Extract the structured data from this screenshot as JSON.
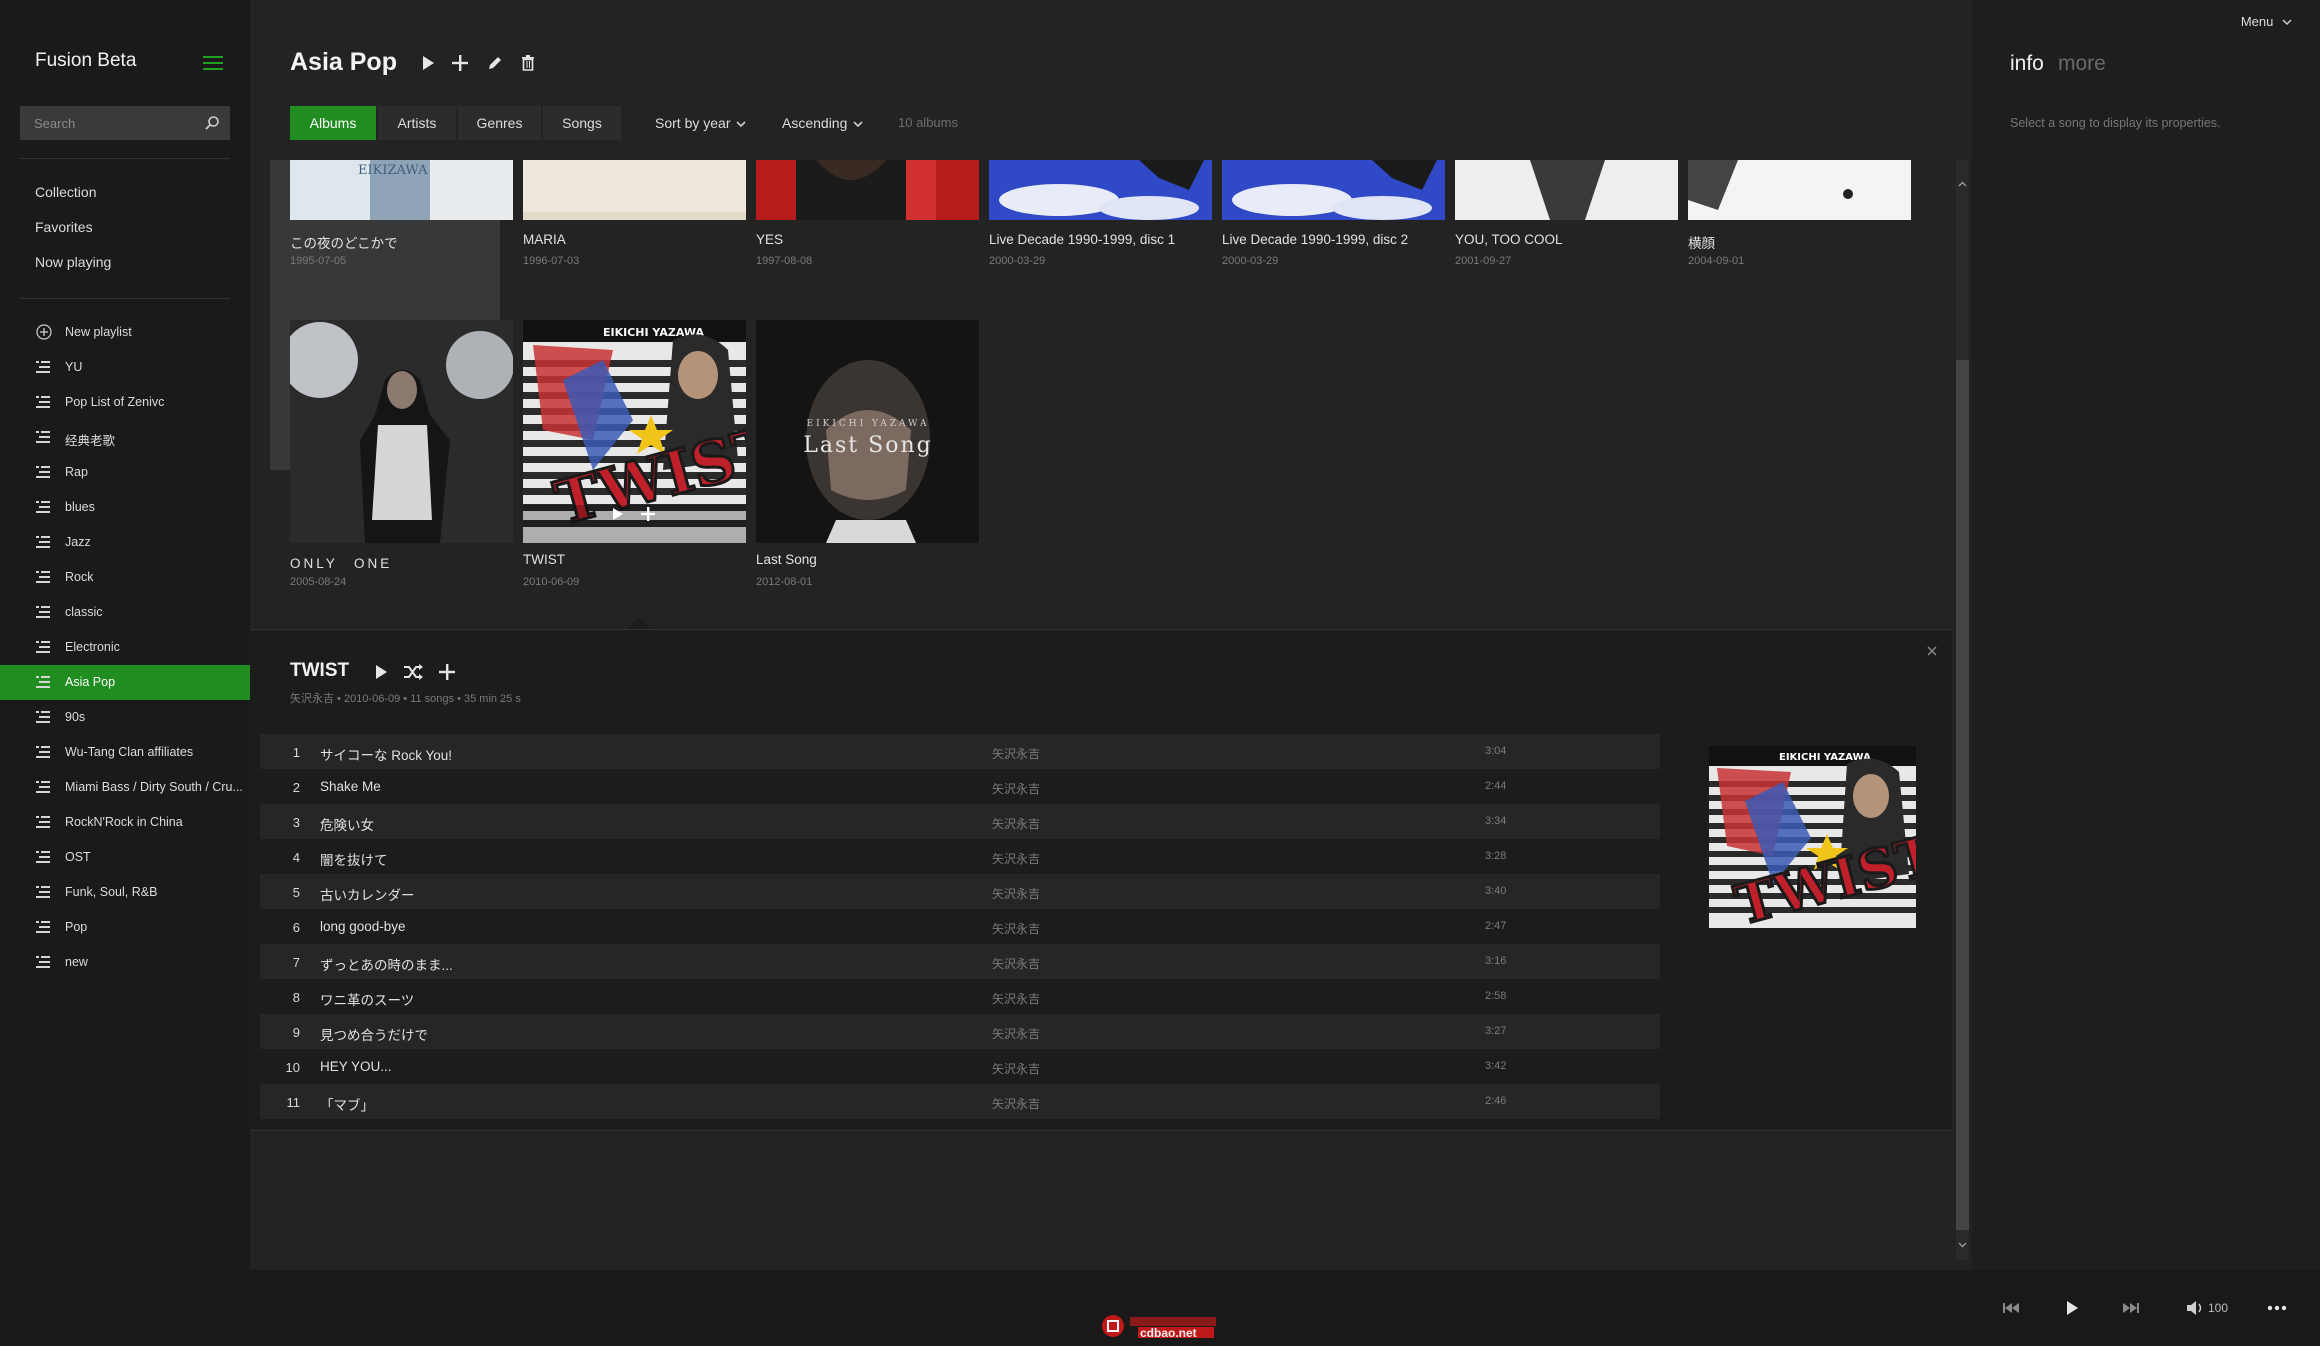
{
  "app": {
    "title": "Fusion Beta"
  },
  "search": {
    "placeholder": "Search"
  },
  "nav": {
    "items": [
      "Collection",
      "Favorites",
      "Now playing"
    ]
  },
  "playlists": {
    "new_label": "New playlist",
    "items": [
      "YU",
      "Pop List of Zenivc",
      "经典老歌",
      "Rap",
      "blues",
      "Jazz",
      "Rock",
      "classic",
      "Electronic",
      "Asia Pop",
      "90s",
      "Wu-Tang Clan affiliates",
      "Miami Bass / Dirty South / Cru...",
      "RockN'Rock in China",
      "OST",
      "Funk, Soul, R&B",
      "Pop",
      "new"
    ],
    "active": "Asia Pop"
  },
  "header": {
    "title": "Asia Pop"
  },
  "tabs": [
    "Albums",
    "Artists",
    "Genres",
    "Songs"
  ],
  "sort": {
    "label": "Sort by year"
  },
  "order": {
    "label": "Ascending"
  },
  "album_count": "10 albums",
  "albums": [
    {
      "title": "この夜のどこかで",
      "date": "1995-07-05"
    },
    {
      "title": "MARIA",
      "date": "1996-07-03"
    },
    {
      "title": "YES",
      "date": "1997-08-08"
    },
    {
      "title": "Live Decade 1990-1999, disc 1",
      "date": "2000-03-29"
    },
    {
      "title": "Live Decade 1990-1999, disc 2",
      "date": "2000-03-29"
    },
    {
      "title": "YOU, TOO COOL",
      "date": "2001-09-27"
    },
    {
      "title": "横顔",
      "date": "2004-09-01"
    },
    {
      "title": "ONLY　ONE",
      "date": "2005-08-24"
    },
    {
      "title": "TWIST",
      "date": "2010-06-09"
    },
    {
      "title": "Last Song",
      "date": "2012-08-01"
    }
  ],
  "art_text": {
    "top_fragment": "EIKIZAWA",
    "twist_band": "EIKICHI YAZAWA",
    "twist_word": "TWIST",
    "last_artist": "EIKICHI YAZAWA",
    "last_title": "Last Song"
  },
  "detail": {
    "title": "TWIST",
    "meta": "矢沢永吉 • 2010-06-09 • 11 songs • 35 min 25 s",
    "tracks": [
      {
        "num": "1",
        "title": "サイコーな Rock You!",
        "artist": "矢沢永吉",
        "duration": "3:04"
      },
      {
        "num": "2",
        "title": "Shake Me",
        "artist": "矢沢永吉",
        "duration": "2:44"
      },
      {
        "num": "3",
        "title": "危険い女",
        "artist": "矢沢永吉",
        "duration": "3:34"
      },
      {
        "num": "4",
        "title": "闇を抜けて",
        "artist": "矢沢永吉",
        "duration": "3:28"
      },
      {
        "num": "5",
        "title": "古いカレンダー",
        "artist": "矢沢永吉",
        "duration": "3:40"
      },
      {
        "num": "6",
        "title": "long good-bye",
        "artist": "矢沢永吉",
        "duration": "2:47"
      },
      {
        "num": "7",
        "title": "ずっとあの時のまま...",
        "artist": "矢沢永吉",
        "duration": "3:16"
      },
      {
        "num": "8",
        "title": "ワニ革のスーツ",
        "artist": "矢沢永吉",
        "duration": "2:58"
      },
      {
        "num": "9",
        "title": "見つめ合うだけで",
        "artist": "矢沢永吉",
        "duration": "3:27"
      },
      {
        "num": "10",
        "title": "HEY YOU...",
        "artist": "矢沢永吉",
        "duration": "3:42"
      },
      {
        "num": "11",
        "title": "「マブ」",
        "artist": "矢沢永吉",
        "duration": "2:46"
      }
    ]
  },
  "info_panel": {
    "menu_label": "Menu",
    "tab_info": "info",
    "tab_more": "more",
    "hint": "Select a song to display its properties."
  },
  "player": {
    "volume": "100"
  },
  "watermark": {
    "text": "cdbao.net"
  },
  "colors": {
    "accent": "#1f8d1f",
    "background": "#232323",
    "sidebar": "#1a1a1a"
  }
}
